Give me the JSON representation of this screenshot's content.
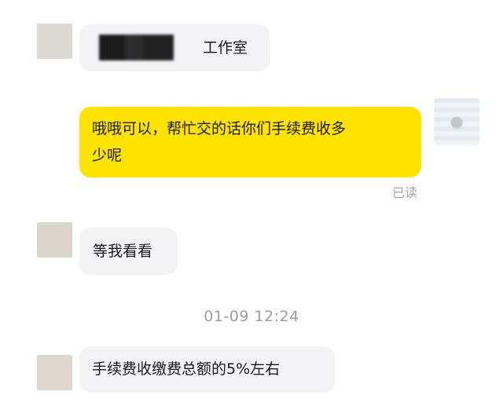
{
  "messages": [
    {
      "side": "left",
      "text": "工作室"
    },
    {
      "side": "right",
      "lines": [
        "哦哦可以，帮忙交的话你们手续费收多",
        "少呢"
      ],
      "status": "已读"
    },
    {
      "side": "left",
      "text": "等我看看"
    },
    {
      "side": "left",
      "text": "手续费收缴费总额的5%左右"
    }
  ],
  "timestamp": "01-09 12:24",
  "colors": {
    "outgoing_bubble": "#ffe300",
    "incoming_bubble": "#f3f3f5",
    "meta_text": "#9e9e9e"
  },
  "icons": {
    "avatar": "avatar-placeholder",
    "redaction": "redacted-name-block"
  }
}
